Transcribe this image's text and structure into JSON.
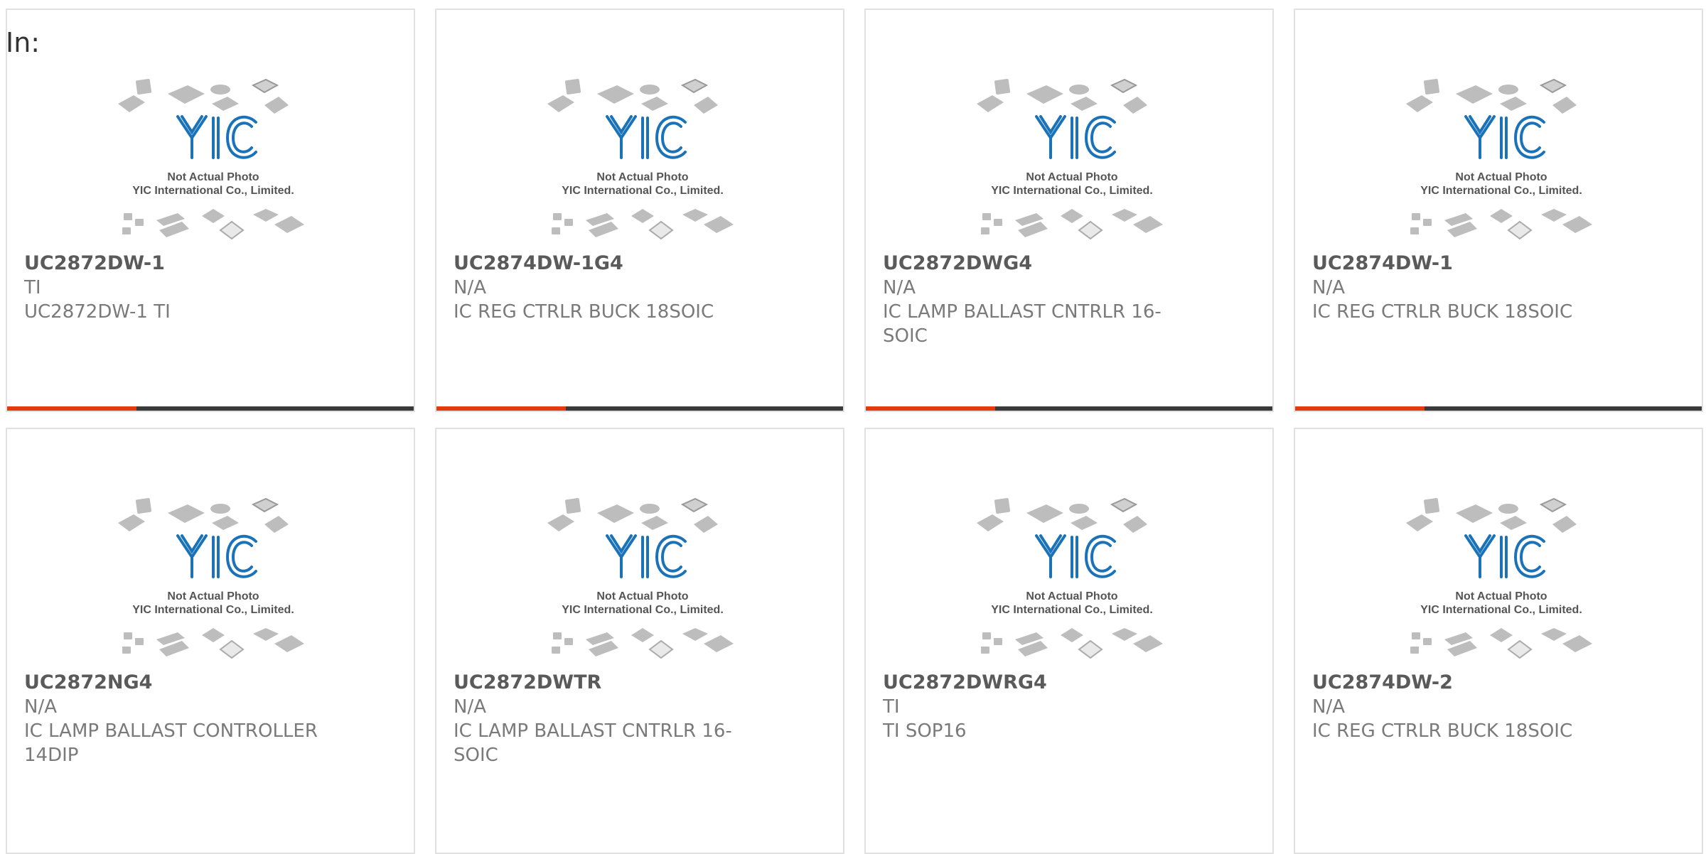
{
  "header": {
    "label": "In:"
  },
  "placeholder": {
    "line1": "Not Actual Photo",
    "line2": "YIC International Co., Limited.",
    "logo": "YIC"
  },
  "colors": {
    "accent": "#e33a10",
    "bar": "#3a3a3a",
    "logo": "#1a73b8"
  },
  "products": [
    {
      "part": "UC2872DW-1",
      "mfr": "TI",
      "desc": "UC2872DW-1 TI"
    },
    {
      "part": "UC2874DW-1G4",
      "mfr": "N/A",
      "desc": "IC REG CTRLR BUCK 18SOIC"
    },
    {
      "part": "UC2872DWG4",
      "mfr": "N/A",
      "desc": "IC LAMP BALLAST CNTRLR 16-SOIC"
    },
    {
      "part": "UC2874DW-1",
      "mfr": "N/A",
      "desc": "IC REG CTRLR BUCK 18SOIC"
    },
    {
      "part": "UC2872NG4",
      "mfr": "N/A",
      "desc": "IC LAMP BALLAST CONTROLLER 14DIP"
    },
    {
      "part": "UC2872DWTR",
      "mfr": "N/A",
      "desc": "IC LAMP BALLAST CNTRLR 16-SOIC"
    },
    {
      "part": "UC2872DWRG4",
      "mfr": "TI",
      "desc": "TI SOP16"
    },
    {
      "part": "UC2874DW-2",
      "mfr": "N/A",
      "desc": "IC REG CTRLR BUCK 18SOIC"
    }
  ]
}
